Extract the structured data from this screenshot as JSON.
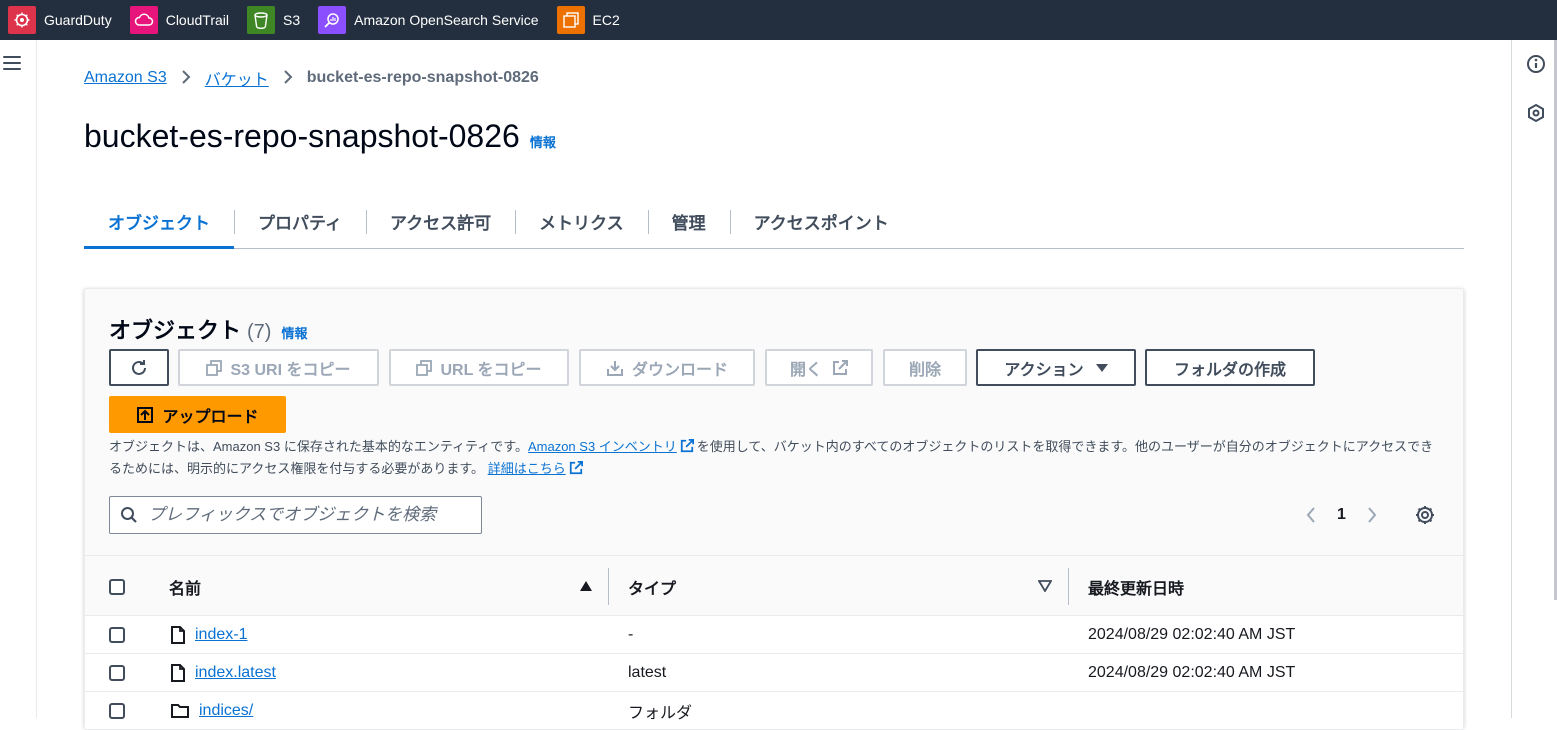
{
  "favorites": [
    {
      "label": "GuardDuty",
      "icon": "guardduty-icon",
      "color": "#dd344c"
    },
    {
      "label": "CloudTrail",
      "icon": "cloudtrail-icon",
      "color": "#e7157b"
    },
    {
      "label": "S3",
      "icon": "s3-icon",
      "color": "#3f8624"
    },
    {
      "label": "Amazon OpenSearch Service",
      "icon": "opensearch-icon",
      "color": "#8c4fff"
    },
    {
      "label": "EC2",
      "icon": "ec2-icon",
      "color": "#ed7100"
    }
  ],
  "breadcrumb": {
    "items": [
      "Amazon S3",
      "バケット"
    ],
    "current": "bucket-es-repo-snapshot-0826"
  },
  "page": {
    "title": "bucket-es-repo-snapshot-0826",
    "info": "情報"
  },
  "tabs": [
    "オブジェクト",
    "プロパティ",
    "アクセス許可",
    "メトリクス",
    "管理",
    "アクセスポイント"
  ],
  "objects": {
    "title": "オブジェクト",
    "count": "(7)",
    "info": "情報",
    "buttons": {
      "copy_s3_uri": "S3 URI をコピー",
      "copy_url": "URL をコピー",
      "download": "ダウンロード",
      "open": "開く",
      "delete": "削除",
      "actions": "アクション",
      "create_folder": "フォルダの作成",
      "upload": "アップロード"
    },
    "description": {
      "part1": "オブジェクトは、Amazon S3 に保存された基本的なエンティティです。",
      "inventory_link": "Amazon S3 インベントリ",
      "part2": "を使用して、バケット内のすべてのオブジェクトのリストを取得できます。他のユーザーが自分のオブジェクトにアクセスできるためには、明示的にアクセス権限を付与する必要があります。",
      "details_link": "詳細はこちら"
    },
    "search_placeholder": "プレフィックスでオブジェクトを検索",
    "page_number": "1",
    "columns": {
      "name": "名前",
      "type": "タイプ",
      "last_modified": "最終更新日時"
    },
    "rows": [
      {
        "name": "index-1",
        "type": "-",
        "last_modified": "2024/08/29 02:02:40 AM JST"
      },
      {
        "name": "index.latest",
        "type": "latest",
        "last_modified": "2024/08/29 02:02:40 AM JST"
      },
      {
        "name": "indices/",
        "type": "フォルダ",
        "last_modified": ""
      }
    ]
  },
  "colors": {
    "accent": "#0972d3",
    "primary_button": "#ff9900",
    "topbar": "#232f3e"
  }
}
